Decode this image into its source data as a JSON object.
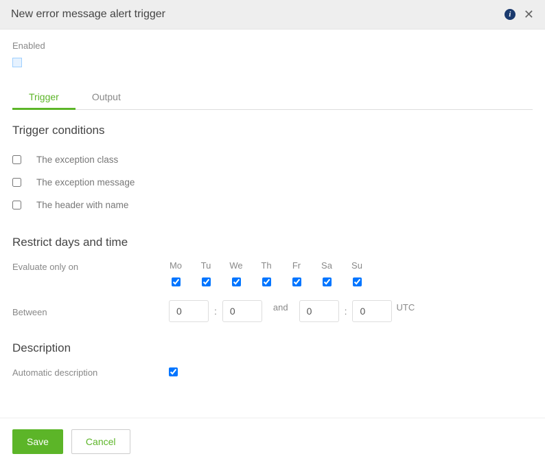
{
  "header": {
    "title": "New error message alert trigger"
  },
  "enabled": {
    "label": "Enabled",
    "checked": false
  },
  "tabs": {
    "trigger": "Trigger",
    "output": "Output",
    "active": "trigger"
  },
  "sections": {
    "conditions_title": "Trigger conditions",
    "conditions": [
      {
        "label": "The exception class",
        "checked": false
      },
      {
        "label": "The exception message",
        "checked": false
      },
      {
        "label": "The header with name",
        "checked": false
      }
    ],
    "restrict_title": "Restrict days and time",
    "evaluate_label": "Evaluate only on",
    "days": [
      {
        "short": "Mo",
        "checked": true
      },
      {
        "short": "Tu",
        "checked": true
      },
      {
        "short": "We",
        "checked": true
      },
      {
        "short": "Th",
        "checked": true
      },
      {
        "short": "Fr",
        "checked": true
      },
      {
        "short": "Sa",
        "checked": true
      },
      {
        "short": "Su",
        "checked": true
      }
    ],
    "between_label": "Between",
    "time": {
      "from_h": "0",
      "from_m": "0",
      "and_label": "and",
      "to_h": "0",
      "to_m": "0",
      "utc_label": "UTC",
      "colon": ":"
    },
    "description_title": "Description",
    "auto_desc_label": "Automatic description",
    "auto_desc_checked": true
  },
  "footer": {
    "save": "Save",
    "cancel": "Cancel"
  }
}
